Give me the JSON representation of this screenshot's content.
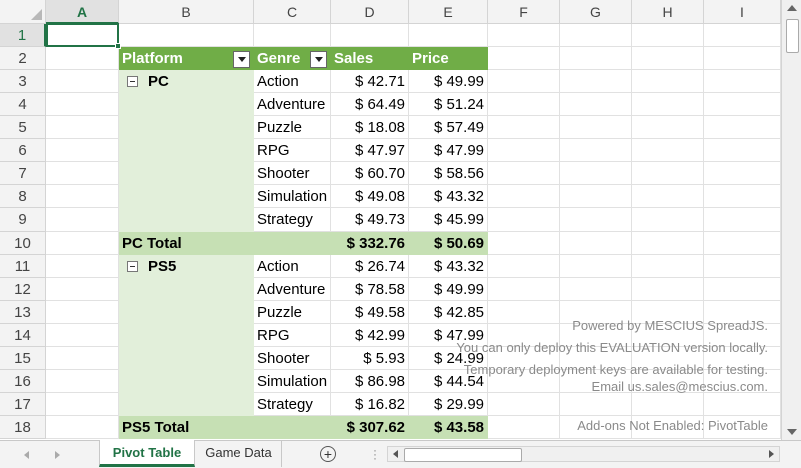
{
  "columns": [
    "A",
    "B",
    "C",
    "D",
    "E",
    "F",
    "G",
    "H",
    "I"
  ],
  "rows": [
    "1",
    "2",
    "3",
    "4",
    "5",
    "6",
    "7",
    "8",
    "9",
    "10",
    "11",
    "12",
    "13",
    "14",
    "15",
    "16",
    "17",
    "18"
  ],
  "pivot": {
    "headers": {
      "platform": "Platform",
      "genre": "Genre",
      "sales": "Sales",
      "price": "Price"
    },
    "pc": {
      "label": "PC",
      "rows": [
        {
          "genre": "Action",
          "sales": "$ 42.71",
          "price": "$ 49.99"
        },
        {
          "genre": "Adventure",
          "sales": "$ 64.49",
          "price": "$ 51.24"
        },
        {
          "genre": "Puzzle",
          "sales": "$ 18.08",
          "price": "$ 57.49"
        },
        {
          "genre": "RPG",
          "sales": "$ 47.97",
          "price": "$ 47.99"
        },
        {
          "genre": "Shooter",
          "sales": "$ 60.70",
          "price": "$ 58.56"
        },
        {
          "genre": "Simulation",
          "sales": "$ 49.08",
          "price": "$ 43.32"
        },
        {
          "genre": "Strategy",
          "sales": "$ 49.73",
          "price": "$ 45.99"
        }
      ],
      "total_label": "PC Total",
      "total_sales": "$ 332.76",
      "total_price": "$ 50.69"
    },
    "ps5": {
      "label": "PS5",
      "rows": [
        {
          "genre": "Action",
          "sales": "$ 26.74",
          "price": "$ 43.32"
        },
        {
          "genre": "Adventure",
          "sales": "$ 78.58",
          "price": "$ 49.99"
        },
        {
          "genre": "Puzzle",
          "sales": "$ 49.58",
          "price": "$ 42.85"
        },
        {
          "genre": "RPG",
          "sales": "$ 42.99",
          "price": "$ 47.99"
        },
        {
          "genre": "Shooter",
          "sales": "$ 5.93",
          "price": "$ 24.99"
        },
        {
          "genre": "Simulation",
          "sales": "$ 86.98",
          "price": "$ 44.54"
        },
        {
          "genre": "Strategy",
          "sales": "$ 16.82",
          "price": "$ 29.99"
        }
      ],
      "total_label": "PS5 Total",
      "total_sales": "$ 307.62",
      "total_price": "$ 43.58"
    }
  },
  "watermark": {
    "line1": "Powered by MESCIUS SpreadJS.",
    "line2": "You can only deploy this EVALUATION version locally.",
    "line3": "Temporary deployment keys are available for testing.",
    "line4": "Email us.sales@mescius.com.",
    "line5": "Add-ons Not Enabled: PivotTable"
  },
  "tabs": {
    "sheet1": "Pivot Table",
    "sheet2": "Game Data",
    "add": "+"
  },
  "colors": {
    "accent": "#217346",
    "pivot_header": "#70ad47",
    "pivot_row": "#e2efda",
    "pivot_total": "#c6e0b4"
  }
}
